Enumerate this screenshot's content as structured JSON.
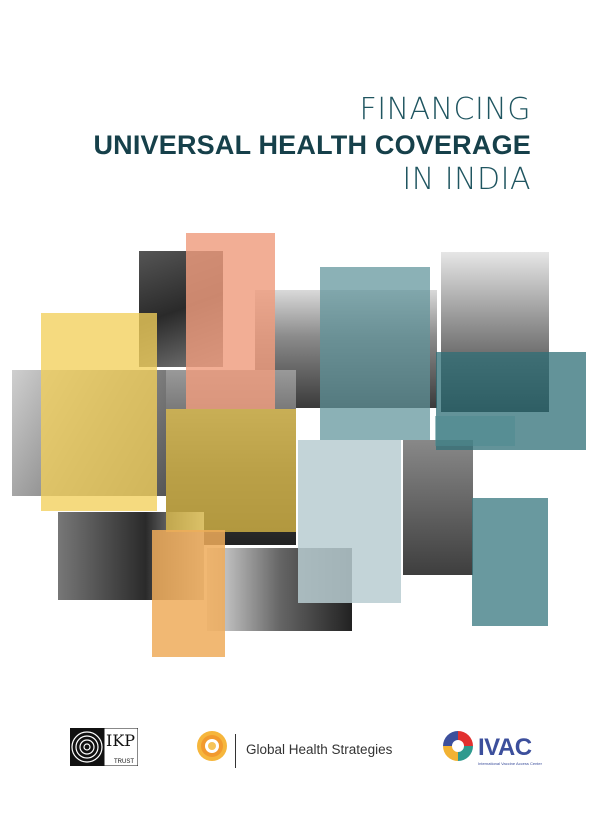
{
  "title": {
    "line1": "FINANCING",
    "line2": "UNIVERSAL HEALTH COVERAGE",
    "line3": "IN INDIA"
  },
  "colors": {
    "title_teal": "#1f5560",
    "title_dark": "#16404a",
    "yellow": "#f2cf5b",
    "salmon": "#ef9c7e",
    "orange": "#efab5a",
    "teal_block": "#4f8a90",
    "teal_light": "#b8cdd1"
  },
  "logos": {
    "ikp_letters": "IKP",
    "ikp_trust": "TRUST",
    "ghs_name": "Global Health Strategies",
    "ivac_name": "IVAC",
    "ivac_subtitle": "International Vaccine Access Center"
  }
}
